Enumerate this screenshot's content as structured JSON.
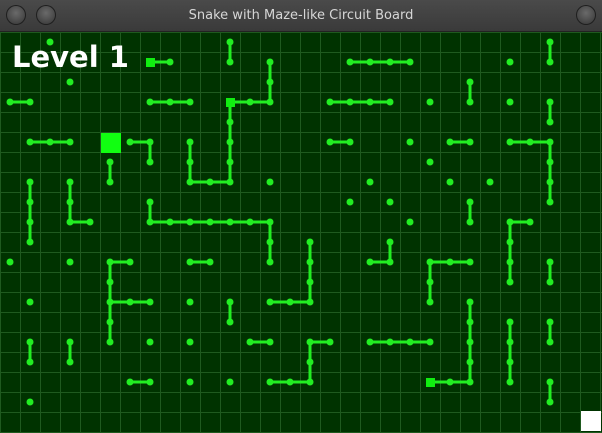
{
  "window": {
    "title": "Snake with Maze-like Circuit Board"
  },
  "hud": {
    "level_text": "Level 1"
  },
  "colors": {
    "background": "#003300",
    "grid_line": "#1f5a1f",
    "trace": "#22ee22",
    "node": "#22ee22",
    "snake": "#11ff11",
    "food": "#11ee11",
    "cursor_block": "#ffffff"
  },
  "game": {
    "grid_columns": 30,
    "grid_rows": 20,
    "snake": {
      "cell": [
        5,
        5
      ]
    },
    "food_items": [
      [
        7,
        1
      ],
      [
        11,
        3
      ],
      [
        21,
        17
      ]
    ],
    "cursor_block": {
      "cell": [
        29,
        19
      ]
    },
    "traces": [
      [
        [
          7,
          1
        ],
        [
          8,
          1
        ]
      ],
      [
        [
          11,
          0
        ],
        [
          11,
          1
        ]
      ],
      [
        [
          13,
          1
        ],
        [
          13,
          2
        ],
        [
          13,
          3
        ]
      ],
      [
        [
          17,
          1
        ],
        [
          18,
          1
        ],
        [
          19,
          1
        ],
        [
          20,
          1
        ]
      ],
      [
        [
          27,
          0
        ],
        [
          27,
          1
        ]
      ],
      [
        [
          0,
          3
        ],
        [
          1,
          3
        ]
      ],
      [
        [
          7,
          3
        ],
        [
          8,
          3
        ],
        [
          9,
          3
        ]
      ],
      [
        [
          11,
          3
        ],
        [
          12,
          3
        ],
        [
          13,
          3
        ]
      ],
      [
        [
          16,
          3
        ],
        [
          17,
          3
        ],
        [
          18,
          3
        ],
        [
          19,
          3
        ]
      ],
      [
        [
          23,
          2
        ],
        [
          23,
          3
        ]
      ],
      [
        [
          27,
          3
        ],
        [
          27,
          4
        ]
      ],
      [
        [
          1,
          5
        ],
        [
          2,
          5
        ],
        [
          3,
          5
        ]
      ],
      [
        [
          6,
          5
        ],
        [
          7,
          5
        ],
        [
          7,
          6
        ]
      ],
      [
        [
          16,
          5
        ],
        [
          17,
          5
        ]
      ],
      [
        [
          22,
          5
        ],
        [
          23,
          5
        ]
      ],
      [
        [
          25,
          5
        ],
        [
          26,
          5
        ],
        [
          27,
          5
        ]
      ],
      [
        [
          9,
          5
        ],
        [
          9,
          6
        ],
        [
          9,
          7
        ],
        [
          10,
          7
        ],
        [
          11,
          7
        ],
        [
          11,
          6
        ],
        [
          11,
          5
        ],
        [
          11,
          4
        ],
        [
          11,
          3
        ]
      ],
      [
        [
          27,
          5
        ],
        [
          27,
          6
        ],
        [
          27,
          7
        ],
        [
          27,
          8
        ]
      ],
      [
        [
          5,
          6
        ],
        [
          5,
          7
        ]
      ],
      [
        [
          1,
          7
        ],
        [
          1,
          8
        ],
        [
          1,
          9
        ],
        [
          1,
          10
        ]
      ],
      [
        [
          3,
          7
        ],
        [
          3,
          8
        ],
        [
          3,
          9
        ],
        [
          4,
          9
        ]
      ],
      [
        [
          7,
          8
        ],
        [
          7,
          9
        ],
        [
          8,
          9
        ],
        [
          9,
          9
        ],
        [
          10,
          9
        ],
        [
          11,
          9
        ],
        [
          12,
          9
        ],
        [
          13,
          9
        ],
        [
          13,
          10
        ],
        [
          13,
          11
        ]
      ],
      [
        [
          23,
          8
        ],
        [
          23,
          9
        ]
      ],
      [
        [
          25,
          9
        ],
        [
          26,
          9
        ]
      ],
      [
        [
          25,
          9
        ],
        [
          25,
          10
        ],
        [
          25,
          11
        ],
        [
          25,
          12
        ]
      ],
      [
        [
          15,
          10
        ],
        [
          15,
          11
        ],
        [
          15,
          12
        ],
        [
          15,
          13
        ],
        [
          14,
          13
        ],
        [
          13,
          13
        ]
      ],
      [
        [
          19,
          10
        ],
        [
          19,
          11
        ],
        [
          18,
          11
        ]
      ],
      [
        [
          5,
          11
        ],
        [
          6,
          11
        ]
      ],
      [
        [
          9,
          11
        ],
        [
          10,
          11
        ]
      ],
      [
        [
          5,
          11
        ],
        [
          5,
          12
        ],
        [
          5,
          13
        ],
        [
          5,
          14
        ],
        [
          5,
          15
        ]
      ],
      [
        [
          5,
          13
        ],
        [
          6,
          13
        ],
        [
          7,
          13
        ]
      ],
      [
        [
          21,
          11
        ],
        [
          22,
          11
        ],
        [
          23,
          11
        ]
      ],
      [
        [
          21,
          11
        ],
        [
          21,
          12
        ],
        [
          21,
          13
        ]
      ],
      [
        [
          27,
          11
        ],
        [
          27,
          12
        ]
      ],
      [
        [
          11,
          13
        ],
        [
          11,
          14
        ]
      ],
      [
        [
          23,
          13
        ],
        [
          23,
          14
        ],
        [
          23,
          15
        ],
        [
          23,
          16
        ],
        [
          23,
          17
        ],
        [
          22,
          17
        ],
        [
          21,
          17
        ]
      ],
      [
        [
          25,
          14
        ],
        [
          25,
          15
        ],
        [
          25,
          16
        ],
        [
          25,
          17
        ]
      ],
      [
        [
          27,
          14
        ],
        [
          27,
          15
        ]
      ],
      [
        [
          1,
          15
        ],
        [
          1,
          16
        ]
      ],
      [
        [
          3,
          15
        ],
        [
          3,
          16
        ]
      ],
      [
        [
          12,
          15
        ],
        [
          13,
          15
        ]
      ],
      [
        [
          15,
          15
        ],
        [
          16,
          15
        ]
      ],
      [
        [
          15,
          15
        ],
        [
          15,
          16
        ],
        [
          15,
          17
        ],
        [
          14,
          17
        ],
        [
          13,
          17
        ]
      ],
      [
        [
          18,
          15
        ],
        [
          19,
          15
        ],
        [
          20,
          15
        ],
        [
          21,
          15
        ]
      ],
      [
        [
          6,
          17
        ],
        [
          7,
          17
        ]
      ],
      [
        [
          27,
          17
        ],
        [
          27,
          18
        ]
      ]
    ],
    "dots": [
      [
        2,
        0
      ],
      [
        3,
        2
      ],
      [
        25,
        1
      ],
      [
        21,
        3
      ],
      [
        25,
        3
      ],
      [
        20,
        5
      ],
      [
        21,
        6
      ],
      [
        13,
        7
      ],
      [
        18,
        7
      ],
      [
        22,
        7
      ],
      [
        24,
        7
      ],
      [
        17,
        8
      ],
      [
        19,
        8
      ],
      [
        20,
        9
      ],
      [
        0,
        11
      ],
      [
        3,
        11
      ],
      [
        1,
        13
      ],
      [
        9,
        13
      ],
      [
        7,
        15
      ],
      [
        9,
        15
      ],
      [
        9,
        17
      ],
      [
        11,
        17
      ],
      [
        1,
        18
      ]
    ]
  }
}
